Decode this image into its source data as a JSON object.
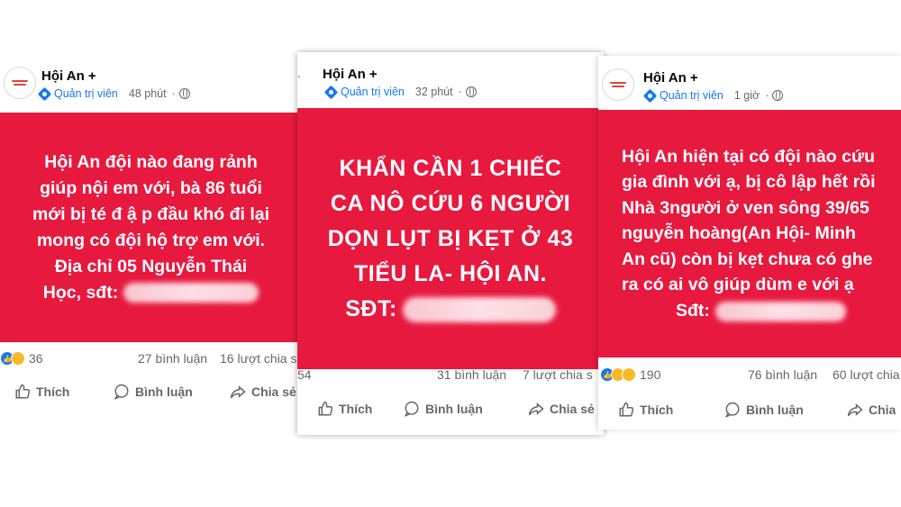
{
  "posts": [
    {
      "page_name": "Hội An +",
      "role": "Quản trị viên",
      "time": "48 phút",
      "separator": "·",
      "content_lines": [
        "Hội An đội nào đang rảnh",
        "giúp nội em với, bà 86 tuổi",
        "mới bị té đ ậ p đầu khó đi lại",
        "mong có đội hộ trợ em với.",
        "Địa chỉ 05 Nguyễn Thái"
      ],
      "last_line_prefix": "Học, sđt:",
      "reaction_count": "36",
      "comments": "27 bình luận",
      "shares": "16 lượt chia s",
      "actions": {
        "like": "Thích",
        "comment": "Bình luận",
        "share": "Chia sẻ"
      }
    },
    {
      "page_name": "Hội An +",
      "role": "Quản trị viên",
      "time": "32 phút",
      "separator": "·",
      "content_lines": [
        "KHẨN CẦN 1 CHIẾC",
        "CA NÔ CỨU 6 NGƯỜI",
        "DỌN LỤT BỊ KẸT Ở 43",
        "TIỂU LA- HỘI AN."
      ],
      "last_line_prefix": "SĐT:",
      "reaction_count": "54",
      "comments": "31 bình luận",
      "shares": "7 lượt chia s",
      "actions": {
        "like": "Thích",
        "comment": "Bình luận",
        "share": "Chia sẻ"
      }
    },
    {
      "page_name": "Hội An +",
      "role": "Quản trị viên",
      "time": "1 giờ",
      "separator": "·",
      "content_lines": [
        "Hội An hiện tại có đội nào cứu",
        "gia đình với ạ, bị cô lập hết rồi",
        "Nhà 3người ở ven sông 39/65",
        "nguyễn hoàng(An Hội- Minh",
        "An cũ) còn bị kẹt chưa có ghe",
        "ra có ai vô giúp dùm e với ạ"
      ],
      "last_line_prefix": "Sđt:",
      "reaction_count": "190",
      "comments": "76 bình luận",
      "shares": "60 lượt chia s",
      "actions": {
        "like": "Thích",
        "comment": "Bình luận",
        "share": "Chia"
      }
    }
  ],
  "icons": {
    "admin": "admin-badge-icon",
    "privacy": "globe-icon",
    "like": "thumbs-up-icon",
    "comment": "comment-bubble-icon",
    "share": "share-arrow-icon"
  },
  "colors": {
    "post_background": "#e8193e",
    "admin_blue": "#1877f2",
    "meta_gray": "#65676b"
  }
}
